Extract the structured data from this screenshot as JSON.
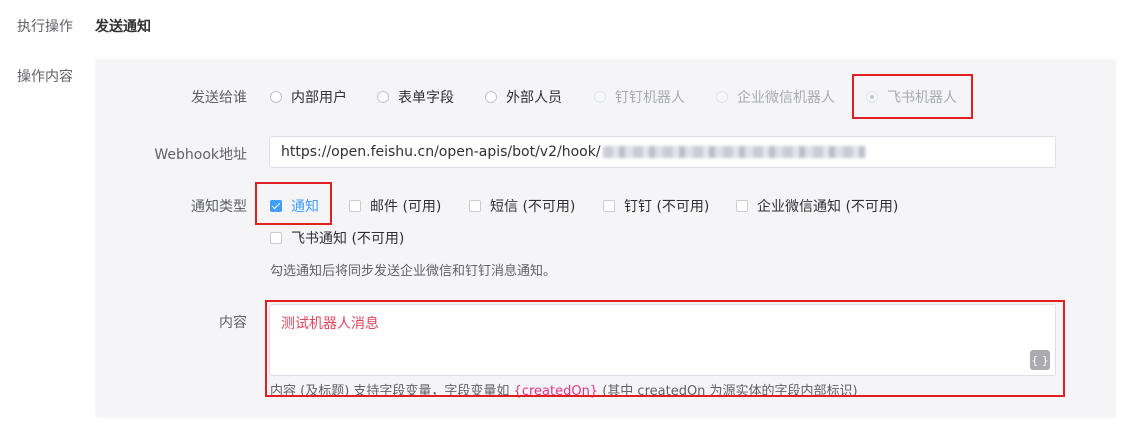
{
  "left_labels": {
    "action": "执行操作",
    "action_value": "发送通知",
    "content": "操作内容"
  },
  "send_to": {
    "label": "发送给谁",
    "options": [
      {
        "label": "内部用户",
        "state": "enabled"
      },
      {
        "label": "表单字段",
        "state": "enabled"
      },
      {
        "label": "外部人员",
        "state": "enabled"
      },
      {
        "label": "钉钉机器人",
        "state": "disabled"
      },
      {
        "label": "企业微信机器人",
        "state": "disabled"
      },
      {
        "label": "飞书机器人",
        "state": "selected-disabled"
      }
    ]
  },
  "webhook": {
    "label": "Webhook地址",
    "value": "https://open.feishu.cn/open-apis/bot/v2/hook/"
  },
  "notify_type": {
    "label": "通知类型",
    "options": [
      {
        "label": "通知",
        "checked": true
      },
      {
        "label": "邮件 (可用)",
        "checked": false
      },
      {
        "label": "短信 (不可用)",
        "checked": false
      },
      {
        "label": "钉钉 (不可用)",
        "checked": false
      },
      {
        "label": "企业微信通知 (不可用)",
        "checked": false
      },
      {
        "label": "飞书通知 (不可用)",
        "checked": false
      }
    ],
    "hint": "勾选通知后将同步发送企业微信和钉钉消息通知。"
  },
  "content": {
    "label": "内容",
    "value": "测试机器人消息",
    "brace_button": "{ }",
    "hint_before": "内容 (及标题) 支持字段变量，字段变量如 ",
    "hint_var": "{createdOn}",
    "hint_after": " (其中 createdOn 为源实体的字段内部标识)"
  },
  "colors": {
    "accent": "#409eff",
    "highlight_box": "#e02020",
    "content_text": "#e0475f",
    "variable": "#e6308a"
  }
}
